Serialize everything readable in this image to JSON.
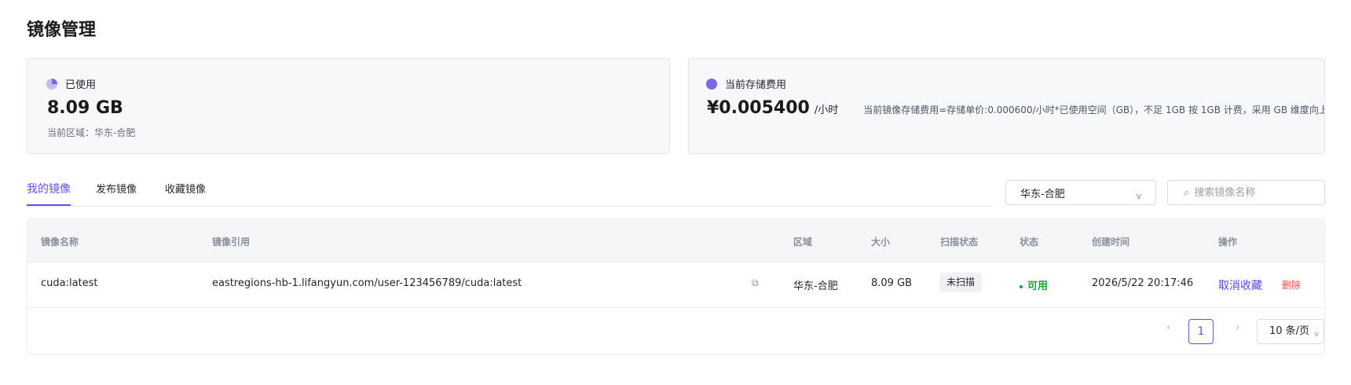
{
  "page": {
    "title": "镜像管理"
  },
  "usage_card": {
    "label": "已使用",
    "value": "8.09 GB",
    "region_text": "当前区域：华东-合肥",
    "icon": "pie-chart-icon",
    "icon_color": "#7d66e6"
  },
  "fee_card": {
    "label": "当前存储费用",
    "value": "¥0.005400",
    "unit": "/小时",
    "note": "当前镜像存储费用=存储单价:0.000600/小时*已使用空间（GB），不足 1GB 按 1GB 计费，采用 GB 维度向上取整计费。",
    "icon": "circle-icon",
    "icon_color": "#7d66e6"
  },
  "tabs": [
    {
      "label": "我的镜像",
      "active": true
    },
    {
      "label": "发布镜像",
      "active": false
    },
    {
      "label": "收藏镜像",
      "active": false
    }
  ],
  "filters": {
    "region_value": "华东-合肥",
    "region_chevron": "v",
    "search_icon": "⌕",
    "search_placeholder": "搜索镜像名称",
    "search_value": ""
  },
  "table": {
    "columns": [
      "镜像名称",
      "镜像引用",
      "区域",
      "大小",
      "扫描状态",
      "状态",
      "创建时间",
      "操作"
    ],
    "rows": [
      {
        "name": "cuda:latest",
        "reference": "eastregions-hb-1.lifangyun.com/user-123456789/cuda:latest",
        "region": "华东-合肥",
        "size": "8.09 GB",
        "scan_status": "未扫描",
        "status": "可用",
        "created": "2026/5/22 20:17:46",
        "action_unfavorite": "取消收藏",
        "action_delete": "删除"
      }
    ]
  },
  "pagination": {
    "prev": "‹",
    "current_page": "1",
    "next": "›",
    "page_size": "10 条/页"
  },
  "colors": {
    "accent": "#6b4ee6",
    "status_ok": "#1aa034",
    "danger": "#e64a4a"
  }
}
